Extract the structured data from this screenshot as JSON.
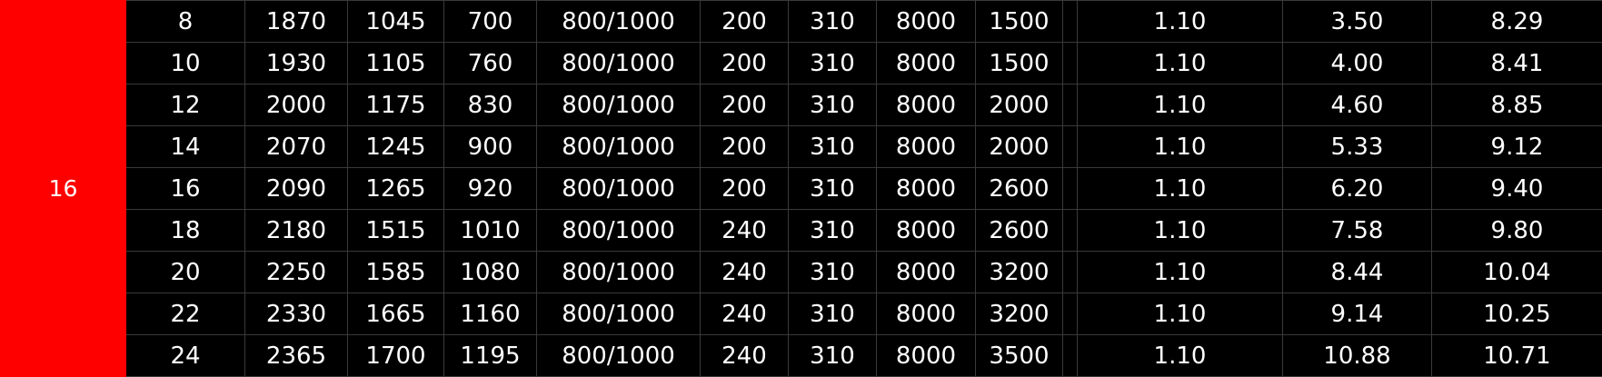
{
  "table": {
    "group_label": "16",
    "rows": [
      [
        "8",
        "1870",
        "1045",
        "700",
        "800/1000",
        "200",
        "310",
        "8000",
        "1500",
        "1.10",
        "3.50",
        "8.29"
      ],
      [
        "10",
        "1930",
        "1105",
        "760",
        "800/1000",
        "200",
        "310",
        "8000",
        "1500",
        "1.10",
        "4.00",
        "8.41"
      ],
      [
        "12",
        "2000",
        "1175",
        "830",
        "800/1000",
        "200",
        "310",
        "8000",
        "2000",
        "1.10",
        "4.60",
        "8.85"
      ],
      [
        "14",
        "2070",
        "1245",
        "900",
        "800/1000",
        "200",
        "310",
        "8000",
        "2000",
        "1.10",
        "5.33",
        "9.12"
      ],
      [
        "16",
        "2090",
        "1265",
        "920",
        "800/1000",
        "200",
        "310",
        "8000",
        "2600",
        "1.10",
        "6.20",
        "9.40"
      ],
      [
        "18",
        "2180",
        "1515",
        "1010",
        "800/1000",
        "240",
        "310",
        "8000",
        "2600",
        "1.10",
        "7.58",
        "9.80"
      ],
      [
        "20",
        "2250",
        "1585",
        "1080",
        "800/1000",
        "240",
        "310",
        "8000",
        "3200",
        "1.10",
        "8.44",
        "10.04"
      ],
      [
        "22",
        "2330",
        "1665",
        "1160",
        "800/1000",
        "240",
        "310",
        "8000",
        "3200",
        "1.10",
        "9.14",
        "10.25"
      ],
      [
        "24",
        "2365",
        "1700",
        "1195",
        "800/1000",
        "240",
        "310",
        "8000",
        "3500",
        "1.10",
        "10.88",
        "10.71"
      ]
    ],
    "colors": {
      "group_background": "#ff0000",
      "table_background": "#000000",
      "text": "#ffffff",
      "grid_line": "#3a3a3a"
    }
  }
}
